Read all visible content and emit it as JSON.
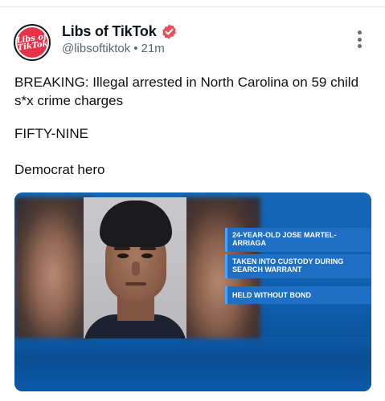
{
  "post": {
    "author": {
      "display_name": "Libs of TikTok",
      "handle": "@libsoftiktok",
      "separator": "•",
      "timestamp": "21m",
      "avatar_text_line1": "Libs of",
      "avatar_text_line2": "TikTok",
      "verified_color": "#e8505b"
    },
    "more_icon": "more-vertical-icon",
    "text_paragraphs": [
      "BREAKING: Illegal arrested in North Carolina on 59 child s*x crime charges",
      "FIFTY-NINE",
      "Democrat hero"
    ],
    "media": {
      "captions": [
        "24-YEAR-OLD JOSE MARTEL-ARRIAGA",
        "TAKEN INTO CUSTODY DURING SEARCH WARRANT",
        "HELD WITHOUT BOND"
      ],
      "accent_color": "#1f6fc5"
    }
  }
}
